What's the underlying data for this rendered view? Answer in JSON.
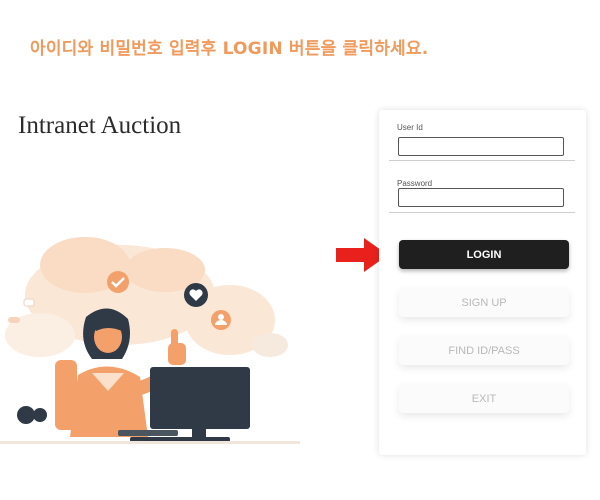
{
  "instruction": "아이디와 비밀번호 입력후 LOGIN 버튼을 클릭하세요.",
  "app_title": "Intranet Auction",
  "form": {
    "userid_label": "User Id",
    "userid_value": "",
    "password_label": "Password",
    "password_value": ""
  },
  "buttons": {
    "login": "LOGIN",
    "signup": "SIGN UP",
    "find": "FIND ID/PASS",
    "exit": "EXIT"
  },
  "colors": {
    "instruction": "#f09a5c",
    "arrow": "#e8211d",
    "primary_button": "#1f1f1f"
  },
  "icons": [
    "arrow-right-icon",
    "heart-icon",
    "check-icon",
    "user-icon"
  ]
}
